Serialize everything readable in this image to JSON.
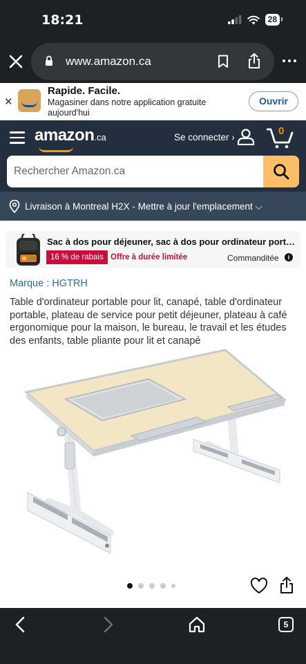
{
  "status_bar": {
    "time": "18:21",
    "battery": "28"
  },
  "browser": {
    "url": "www.amazon.ca"
  },
  "app_banner": {
    "title": "Rapide. Facile.",
    "subtitle": "Magasiner dans notre application gratuite aujourd'hui",
    "open_label": "Ouvrir"
  },
  "header": {
    "logo_text": "amazon",
    "logo_tld": ".ca",
    "signin_label": "Se connecter ›",
    "cart_count": "0",
    "search_placeholder": "Rechercher Amazon.ca"
  },
  "delivery": {
    "text": "Livraison à Montreal H2X - Mettre à jour l'emplacement ⌵"
  },
  "sponsored": {
    "title": "Sac à dos pour déjeuner, sac à dos pour ordinateur portable d...",
    "discount": "16 % de rabais",
    "deal": "Offre à durée limitée",
    "sponsored_label": "Commanditée",
    "info": "i"
  },
  "product": {
    "brand": "Marque : HGTRH",
    "title": "Table d'ordinateur portable pour lit, canapé, table d'ordinateur portable, plateau de service pour petit déjeuner, plateau à café ergonomique pour la maison, le bureau, le travail et les études des enfants, table pliante pour lit et canapé"
  },
  "carousel": {
    "total": 5,
    "active": 1
  },
  "bottom_nav": {
    "tabs_count": "5"
  },
  "colors": {
    "header_bg": "#232f3e",
    "delivery_bg": "#37475a",
    "search_button": "#febd69",
    "accent_orange": "#ff9900",
    "deal_red": "#cc0c39",
    "link_blue": "#2a6f97"
  }
}
